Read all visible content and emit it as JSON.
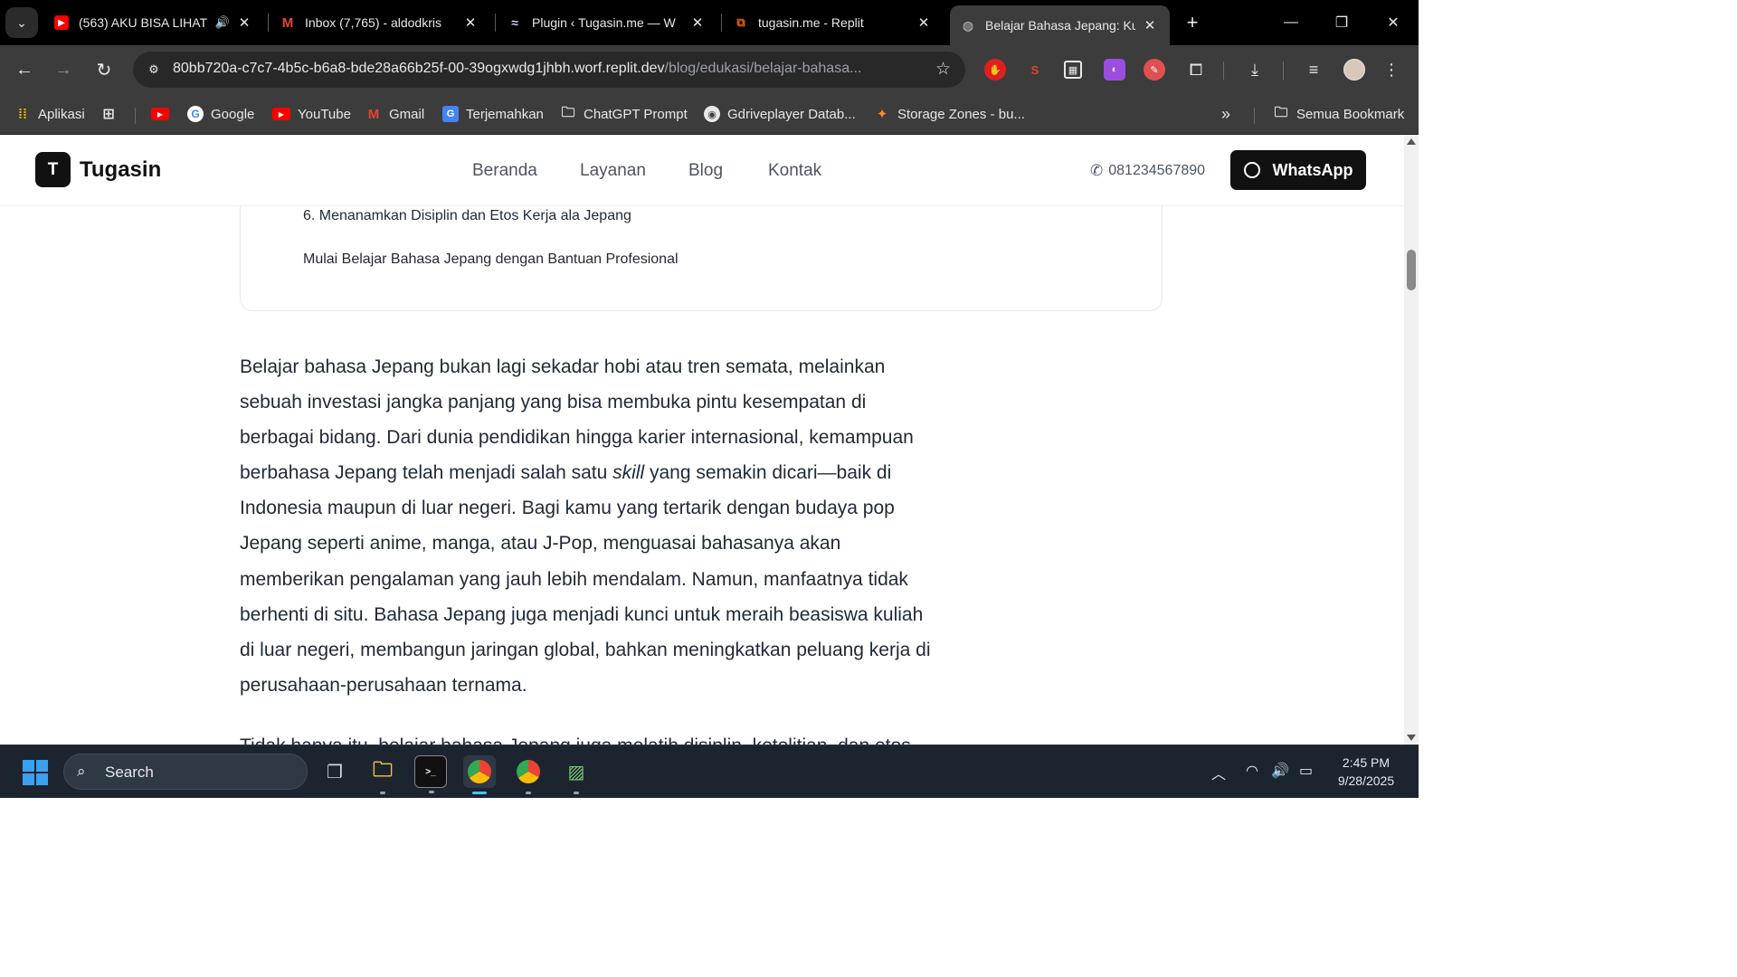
{
  "browser": {
    "tabs": [
      {
        "title": "(563) AKU BISA LIHAT",
        "favicon": "youtube-icon",
        "extra": "speaker-icon"
      },
      {
        "title": "Inbox (7,765) - aldodkris",
        "favicon": "gmail-icon"
      },
      {
        "title": "Plugin ‹ Tugasin.me — W",
        "favicon": "wordpress-icon"
      },
      {
        "title": "tugasin.me - Replit",
        "favicon": "replit-icon"
      },
      {
        "title": "Belajar Bahasa Jepang: Ku",
        "favicon": "globe-icon",
        "active": true
      }
    ],
    "url_host": "80bb720a-c7c7-4b5c-b6a8-bde28a66b25f-00-39ogxwdg1jhbh.worf.replit.dev",
    "url_path": "/blog/edukasi/belajar-bahasa...",
    "bookmarks": [
      {
        "label": "Aplikasi",
        "icon": "apps-grid-icon"
      },
      {
        "label": "",
        "icon": "tab-groups-icon"
      },
      {
        "label": "",
        "icon": "youtube-icon"
      },
      {
        "label": "Google",
        "icon": "google-icon"
      },
      {
        "label": "YouTube",
        "icon": "youtube-icon"
      },
      {
        "label": "Gmail",
        "icon": "gmail-icon"
      },
      {
        "label": "Terjemahkan",
        "icon": "translate-icon"
      },
      {
        "label": "ChatGPT Prompt",
        "icon": "folder-icon"
      },
      {
        "label": "Gdriveplayer Datab...",
        "icon": "chrome-icon"
      },
      {
        "label": "Storage Zones - bu...",
        "icon": "bunny-icon"
      }
    ],
    "all_bookmarks": "Semua Bookmark"
  },
  "site": {
    "logo_letter": "T",
    "logo_text": "Tugasin",
    "nav": [
      "Beranda",
      "Layanan",
      "Blog",
      "Kontak"
    ],
    "phone": "081234567890",
    "whatsapp_label": "WhatsApp"
  },
  "toc": {
    "items": [
      "6. Menanamkan Disiplin dan Etos Kerja ala Jepang",
      "Mulai Belajar Bahasa Jepang dengan Bantuan Profesional"
    ]
  },
  "article": {
    "p1_before_em": "Belajar bahasa Jepang bukan lagi sekadar hobi atau tren semata, melainkan sebuah investasi jangka panjang yang bisa membuka pintu kesempatan di berbagai bidang. Dari dunia pendidikan hingga karier internasional, kemampuan berbahasa Jepang telah menjadi salah satu ",
    "p1_em": "skill",
    "p1_after_em": " yang semakin dicari—baik di Indonesia maupun di luar negeri. Bagi kamu yang tertarik dengan budaya pop Jepang seperti anime, manga, atau J-Pop, menguasai bahasanya akan memberikan pengalaman yang jauh lebih mendalam. Namun, manfaatnya tidak berhenti di situ. Bahasa Jepang juga menjadi kunci untuk meraih beasiswa kuliah di luar negeri, membangun jaringan global, bahkan meningkatkan peluang kerja di perusahaan-perusahaan ternama.",
    "p2_partial": "Tidak hanya itu, belajar bahasa Jepang juga melatih disiplin, ketelitian, dan etos"
  },
  "taskbar": {
    "search_placeholder": "Search",
    "time": "2:45 PM",
    "date": "9/28/2025"
  },
  "colors": {
    "chrome_dark": "#000000",
    "chrome_toolbar": "#3c3c3c",
    "site_dark": "#111111",
    "taskbar": "#1c2430"
  }
}
